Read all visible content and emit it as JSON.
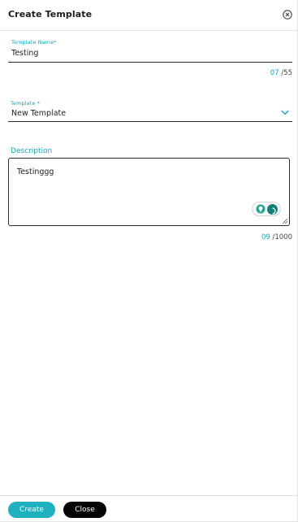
{
  "dialog": {
    "title": "Create Template"
  },
  "template_name": {
    "label": "Template Name*",
    "value": "Testing",
    "count": "07",
    "max": "/55"
  },
  "template": {
    "label": "Template *",
    "value": "New Template"
  },
  "description": {
    "label": "Description",
    "value": "Testinggg",
    "count": "09",
    "max": "/1000"
  },
  "footer": {
    "create_label": "Create",
    "close_label": "Close"
  },
  "colors": {
    "accent": "#1aa6b7",
    "primary_button": "#1fb1bf",
    "secondary_button": "#050505",
    "ai_toggle": "#127c75"
  },
  "icons": {
    "close": "close-circle-icon",
    "chevron": "chevron-down-icon",
    "bulb": "lightbulb-icon",
    "toggle": "circle-toggle-icon",
    "resize": "resize-grip-icon"
  }
}
